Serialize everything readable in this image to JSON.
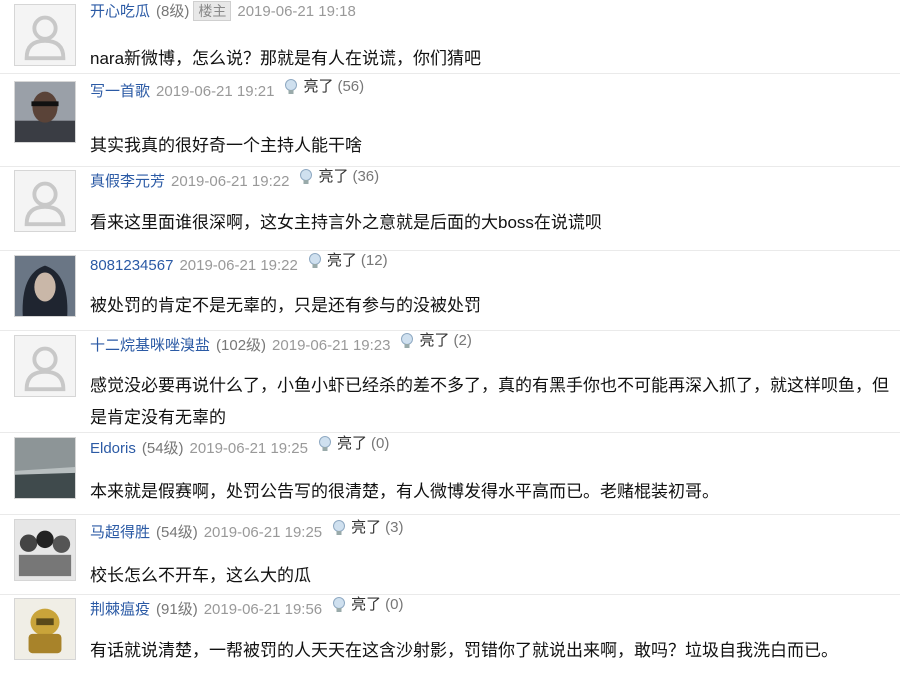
{
  "comments": [
    {
      "user": "开心吃瓜",
      "level": "(8级)",
      "badge": "楼主",
      "time": "2019-06-21 19:18",
      "like_label": "",
      "like_count": "",
      "text": "nara新微博，怎么说？那就是有人在说谎，你们猜吧",
      "avatar": "default"
    },
    {
      "user": "写一首歌",
      "level": "",
      "badge": "",
      "time": "2019-06-21 19:21",
      "like_label": "亮了",
      "like_count": "(56)",
      "text": "其实我真的很好奇一个主持人能干啥",
      "avatar": "man-dark"
    },
    {
      "user": "真假李元芳",
      "level": "",
      "badge": "",
      "time": "2019-06-21 19:22",
      "like_label": "亮了",
      "like_count": "(36)",
      "text": "看来这里面谁很深啊，这女主持言外之意就是后面的大boss在说谎呗",
      "avatar": "default"
    },
    {
      "user": "8081234567",
      "level": "",
      "badge": "",
      "time": "2019-06-21 19:22",
      "like_label": "亮了",
      "like_count": "(12)",
      "text": "被处罚的肯定不是无辜的，只是还有参与的没被处罚",
      "avatar": "longhair"
    },
    {
      "user": "十二烷基咪唑溴盐",
      "level": "(102级)",
      "badge": "",
      "time": "2019-06-21 19:23",
      "like_label": "亮了",
      "like_count": "(2)",
      "text": "感觉没必要再说什么了，小鱼小虾已经杀的差不多了，真的有黑手你也不可能再深入抓了，就这样呗鱼，但是肯定没有无辜的",
      "avatar": "default"
    },
    {
      "user": "Eldoris",
      "level": "(54级)",
      "badge": "",
      "time": "2019-06-21 19:25",
      "like_label": "亮了",
      "like_count": "(0)",
      "text": "本来就是假赛啊，处罚公告写的很清楚，有人微博发得水平高而已。老赌棍装初哥。",
      "avatar": "sea"
    },
    {
      "user": "马超得胜",
      "level": "(54级)",
      "badge": "",
      "time": "2019-06-21 19:25",
      "like_label": "亮了",
      "like_count": "(3)",
      "text": "校长怎么不开车，这么大的瓜",
      "avatar": "group"
    },
    {
      "user": "荆棘瘟疫",
      "level": "(91级)",
      "badge": "",
      "time": "2019-06-21 19:56",
      "like_label": "亮了",
      "like_count": "(0)",
      "text": "有话就说清楚，一帮被罚的人天天在这含沙射影，罚错你了就说出来啊，敢吗？垃圾自我洗白而已。",
      "avatar": "gold"
    }
  ]
}
